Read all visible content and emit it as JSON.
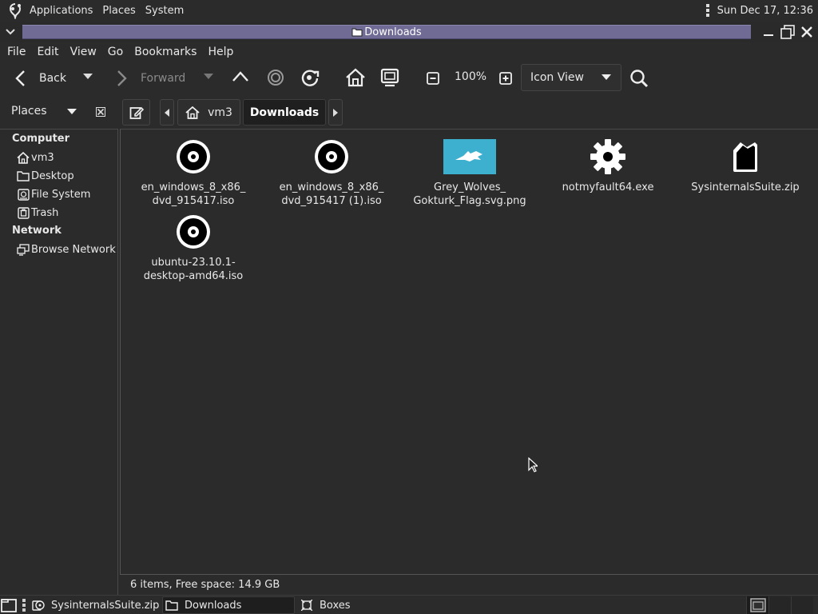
{
  "top_panel": {
    "menus": [
      "Applications",
      "Places",
      "System"
    ],
    "clock": "Sun Dec 17, 12:36"
  },
  "window": {
    "title": "Downloads"
  },
  "menubar": [
    "File",
    "Edit",
    "View",
    "Go",
    "Bookmarks",
    "Help"
  ],
  "toolbar": {
    "back_label": "Back",
    "forward_label": "Forward",
    "zoom_level": "100%",
    "view_mode": "Icon View"
  },
  "location": {
    "places_label": "Places",
    "path": [
      "vm3",
      "Downloads"
    ]
  },
  "sidebar": {
    "computer_heading": "Computer",
    "network_heading": "Network",
    "computer_items": [
      "vm3",
      "Desktop",
      "File System",
      "Trash"
    ],
    "network_items": [
      "Browse Network"
    ]
  },
  "files": [
    {
      "name": "en_windows_8_x86_\ndvd_915417.iso",
      "icon": "disc-icon"
    },
    {
      "name": "en_windows_8_x86_\ndvd_915417 (1).iso",
      "icon": "disc-icon"
    },
    {
      "name": "Grey_Wolves_\nGokturk_Flag.svg.png",
      "icon": "image-thumbnail"
    },
    {
      "name": "notmyfault64.exe",
      "icon": "gear-icon"
    },
    {
      "name": "SysinternalsSuite.zip",
      "icon": "package-icon"
    },
    {
      "name": "ubuntu-23.10.1-\ndesktop-amd64.iso",
      "icon": "disc-icon"
    }
  ],
  "statusbar": {
    "text": "6 items, Free space: 14.9 GB"
  },
  "taskbar": {
    "tasks": [
      "SysinternalsSuite.zip",
      "Downloads",
      "Boxes"
    ]
  },
  "colors": {
    "background": "#2b2b2b",
    "title_strip": "#6f6b95",
    "flag_thumb": "#3eb0cf"
  }
}
